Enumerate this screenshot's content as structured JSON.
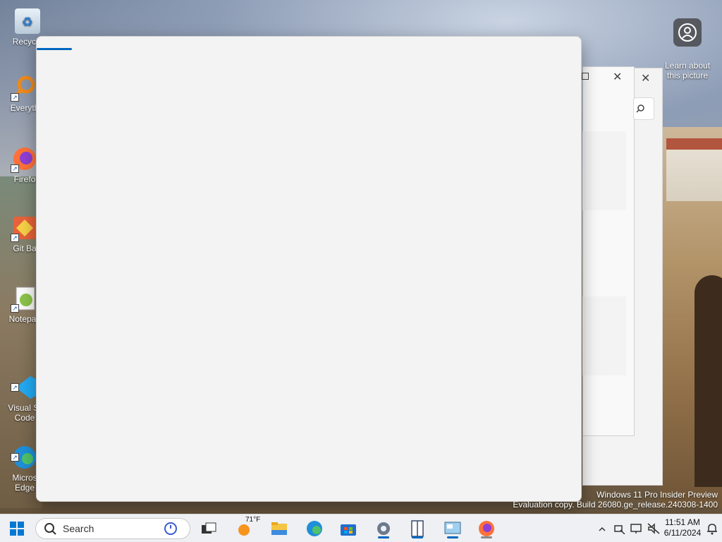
{
  "desktop": {
    "icons": [
      {
        "label": "Recycle",
        "name": "recycle-bin"
      },
      {
        "label": "Everyth",
        "name": "everything"
      },
      {
        "label": "Firefo",
        "name": "firefox"
      },
      {
        "label": "Git Ba",
        "name": "git-bash"
      },
      {
        "label": "Notepac",
        "name": "notepad-plus-plus"
      },
      {
        "label": "Visual St\nCode",
        "name": "visual-studio-code"
      },
      {
        "label": "Micros\nEdge",
        "name": "microsoft-edge"
      }
    ],
    "learn_about": "Learn about\nthis picture"
  },
  "watermark": {
    "line1": "Windows 11 Pro Insider Preview",
    "line2": "Evaluation copy. Build 26080.ge_release.240308-1400"
  },
  "main_window": {
    "progress": 0.065
  },
  "taskbar": {
    "search_label": "Search",
    "weather_temp": "71°F",
    "time": "11:51 AM",
    "date": "6/11/2024"
  },
  "colors": {
    "accent": "#0067c0",
    "window_bg": "#f3f3f3",
    "taskbar_bg": "#eef0f3"
  }
}
